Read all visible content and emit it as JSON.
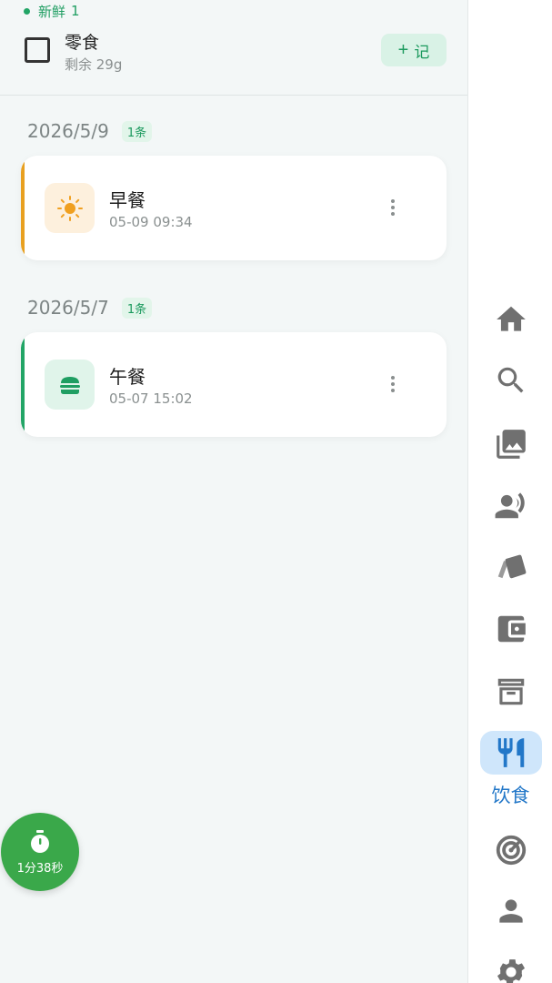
{
  "snack": {
    "fresh_label": "新鲜",
    "fresh_count": "1",
    "name": "零食",
    "remaining": "剩余 29g",
    "record_plus": "+",
    "record_label": "记"
  },
  "groups": [
    {
      "date": "2026/5/9",
      "count": "1条",
      "meals": [
        {
          "title": "早餐",
          "time": "05-09 09:34",
          "icon": "sun-icon",
          "accent": "#e8a020",
          "icon_bg": "#fdf0dd",
          "icon_color": "#f0a020"
        }
      ]
    },
    {
      "date": "2026/5/7",
      "count": "1条",
      "meals": [
        {
          "title": "午餐",
          "time": "05-07 15:02",
          "icon": "burger-icon",
          "accent": "#22a566",
          "icon_bg": "#e0f4ea",
          "icon_color": "#1f9e62"
        }
      ]
    }
  ],
  "timer": {
    "label": "1分38秒",
    "icon": "stopwatch-icon"
  },
  "rail": {
    "items": [
      "home-icon",
      "search-icon",
      "gallery-icon",
      "voice-person-icon",
      "cards-icon",
      "wallet-icon",
      "archive-icon",
      "utensils-icon",
      "target-icon",
      "person-icon",
      "gear-icon"
    ],
    "active_label": "饮食",
    "colors": {
      "icon": "#707070",
      "active": "#2277c8",
      "active_bg": "#cfe6fb"
    }
  }
}
